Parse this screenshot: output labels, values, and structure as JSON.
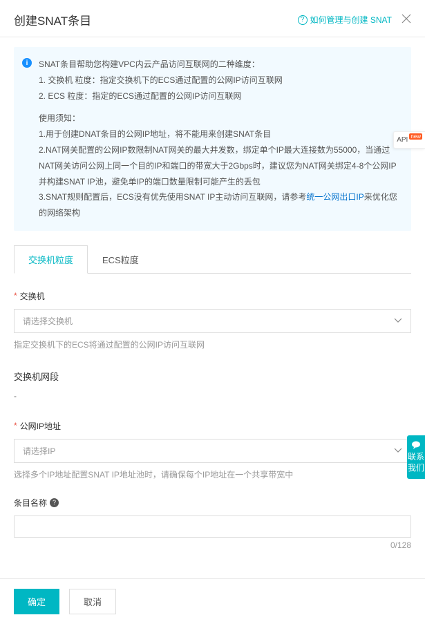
{
  "header": {
    "title": "创建SNAT条目",
    "help_link": "如何管理与创建 SNAT"
  },
  "info": {
    "intro": "SNAT条目帮助您构建VPC内云产品访问互联网的二种维度：",
    "line1": "1. 交换机 粒度：指定交换机下的ECS通过配置的公网IP访问互联网",
    "line2": "2. ECS 粒度：指定的ECS通过配置的公网IP访问互联网",
    "notice_title": "使用须知：",
    "n1": "1.用于创建DNAT条目的公网IP地址，将不能用来创建SNAT条目",
    "n2a": "2.NAT网关配置的公网IP数限制NAT网关的最大并发数，绑定单个IP最大连接数为55000，当通过NAT网关访问公网上同一个目的IP和端口的带宽大于2Gbps时，建议您为NAT网关绑定4-8个公网IP并构建SNAT IP池，避免单IP的端口数量限制可能产生的丢包",
    "n3a": "3.SNAT规则配置后，ECS没有优先使用SNAT IP主动访问互联网，请参考",
    "n3link": "统一公网出口IP",
    "n3b": "来优化您的网络架构"
  },
  "tabs": {
    "tab1": "交换机粒度",
    "tab2": "ECS粒度"
  },
  "form": {
    "vswitch_label": "交换机",
    "vswitch_placeholder": "请选择交换机",
    "vswitch_hint": "指定交换机下的ECS将通过配置的公网IP访问互联网",
    "cidr_label": "交换机网段",
    "cidr_value": "-",
    "eip_label": "公网IP地址",
    "eip_placeholder": "请选择IP",
    "eip_hint": "选择多个IP地址配置SNAT IP地址池时，请确保每个IP地址在一个共享带宽中",
    "name_label": "条目名称",
    "name_count": "0/128"
  },
  "footer": {
    "ok": "确定",
    "cancel": "取消"
  },
  "side": {
    "api": "API",
    "api_new": "new",
    "contact": "联系我们"
  }
}
